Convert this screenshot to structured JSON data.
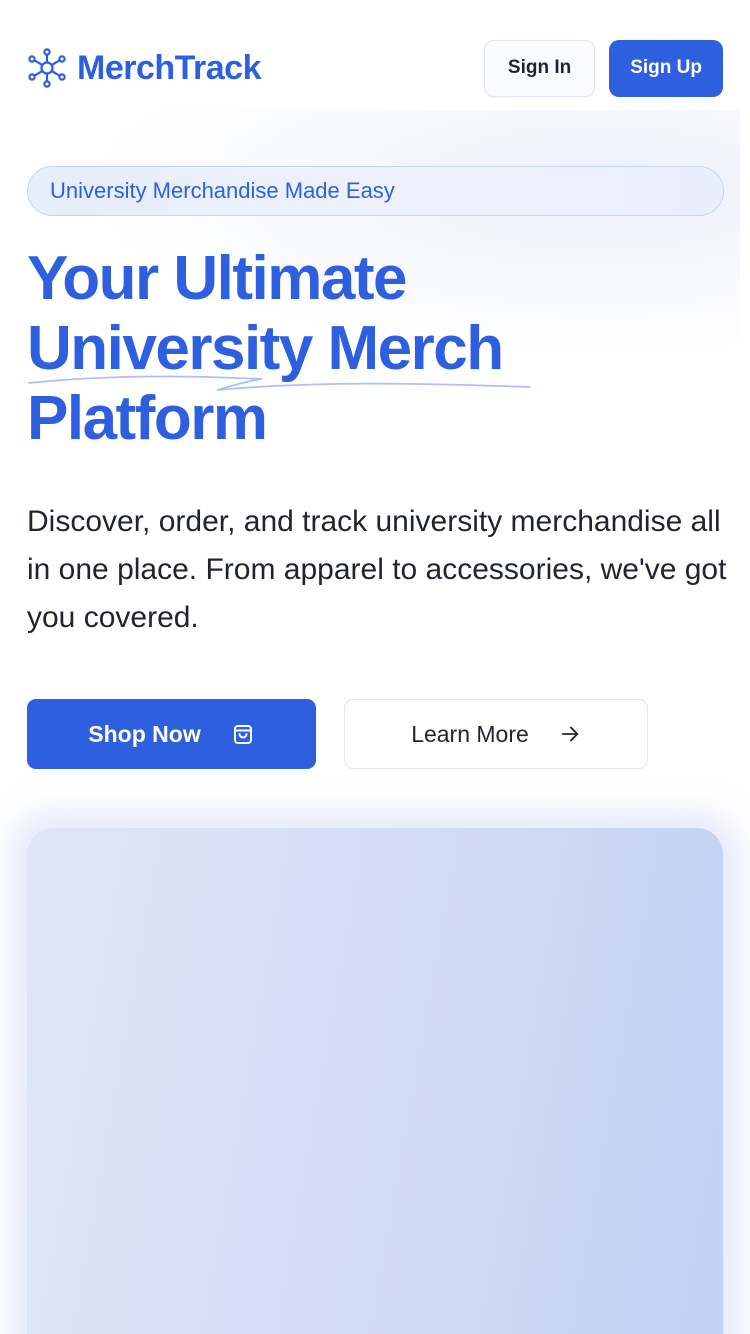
{
  "header": {
    "brand_name": "MerchTrack",
    "logo_icon": "network-icon",
    "sign_in_label": "Sign In",
    "sign_up_label": "Sign Up"
  },
  "hero": {
    "badge_text": "University Merchandise Made Easy",
    "headline_lines": [
      "Your Ultimate",
      "University Merch",
      "Platform"
    ],
    "description": "Discover, order, and track university merchandise all in one place. From apparel to accessories, we've got you covered.",
    "primary_cta": {
      "label": "Shop Now",
      "icon": "shopping-bag-icon"
    },
    "secondary_cta": {
      "label": "Learn More",
      "icon": "arrow-right-icon"
    }
  },
  "colors": {
    "accent": "#2e5fde",
    "text": "#1f2430",
    "badge_border": "#c7d3f3",
    "badge_bg": "#e6edfb",
    "image_placeholder": "#d3ddf6"
  }
}
